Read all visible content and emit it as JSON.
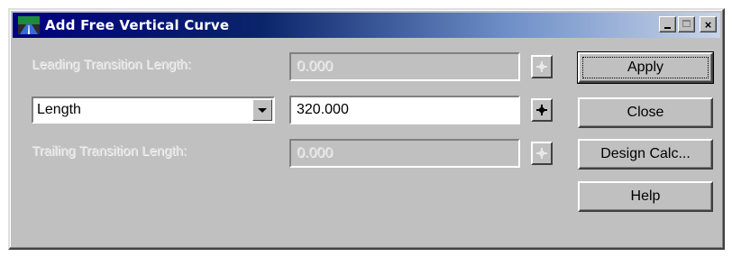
{
  "window": {
    "title": "Add Free Vertical Curve",
    "icon": "road-perspective-icon",
    "controls": {
      "minimize": "_",
      "maximize": "□",
      "close": "×"
    }
  },
  "leading": {
    "label": "Leading Transition Length:",
    "value": "0.000",
    "enabled": false
  },
  "curve": {
    "select_value": "Length",
    "value": "320.000",
    "enabled": true
  },
  "trailing": {
    "label": "Trailing Transition Length:",
    "value": "0.000",
    "enabled": false
  },
  "buttons": {
    "apply": "Apply",
    "close": "Close",
    "design_calc": "Design Calc...",
    "help": "Help"
  },
  "colors": {
    "titlebar_start": "#000080",
    "face": "#c0c0c0"
  }
}
